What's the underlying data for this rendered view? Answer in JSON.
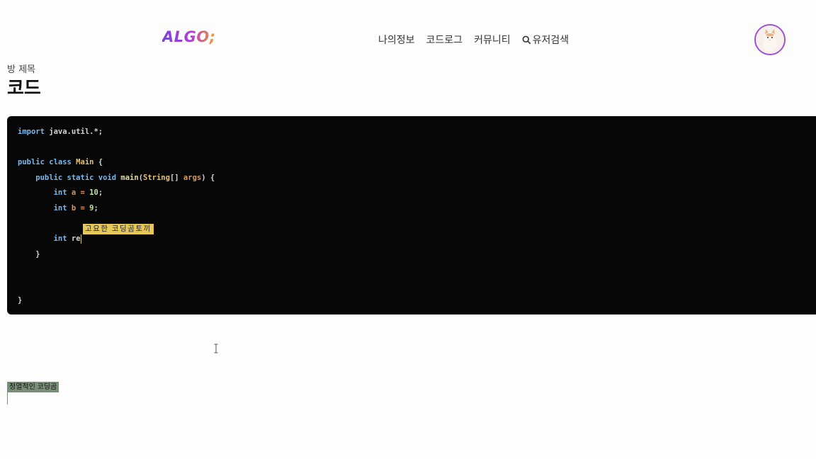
{
  "header": {
    "logo": "ALGO;",
    "nav": {
      "my_info": "나의정보",
      "code_log": "코드로그",
      "community": "커뮤니티",
      "user_search": "유저검색"
    }
  },
  "room": {
    "label": "방 제목",
    "title": "코드"
  },
  "editor": {
    "lines": {
      "l1_kw": "import",
      "l1_rest": " java.util.*;",
      "l3_kw": "public class",
      "l3_name": " Main",
      "l3_rest": " {",
      "l4_kw": "    public static void",
      "l4_fn": " main",
      "l4_p1": "(",
      "l4_ty": "String",
      "l4_p2": "[] ",
      "l4_arg": "args",
      "l4_p3": ") {",
      "l5_kw": "        int",
      "l5_rest": " a = ",
      "l5_num": "10",
      "l5_end": ";",
      "l6_kw": "        int",
      "l6_rest": " b = ",
      "l6_num": "9",
      "l6_end": ";",
      "l8_kw": "        int",
      "l8_rest": " re",
      "l9": "    }",
      "l12": "}"
    },
    "remote_user": "고요한 코딩곰토끼"
  },
  "chat": {
    "user_tag": "정열적인 코딩곰"
  }
}
